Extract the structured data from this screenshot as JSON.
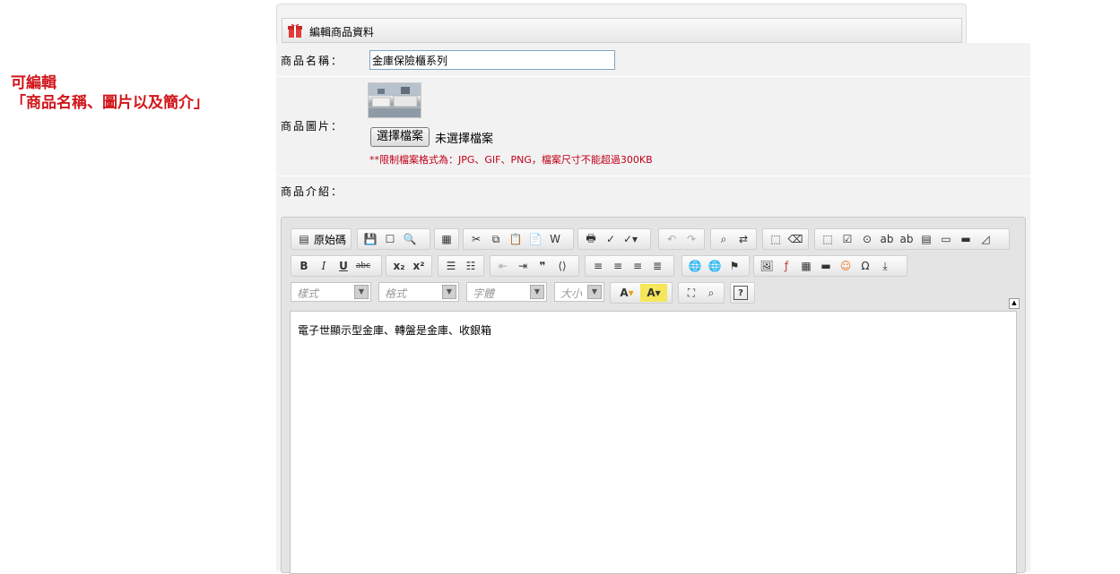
{
  "annotation": {
    "line1": "可編輯",
    "line2": "「商品名稱、圖片以及簡介」"
  },
  "panel": {
    "title": "編輯商品資料"
  },
  "form": {
    "name_label": "商品名稱：",
    "name_value": "金庫保險櫃系列",
    "image_label": "商品圖片：",
    "file_button": "選擇檔案",
    "file_status": "未選擇檔案",
    "file_note": "**限制檔案格式為：JPG、GIF、PNG，檔案尺寸不能超過300KB",
    "intro_label": "商品介紹："
  },
  "editor": {
    "source_label": "原始碼",
    "style_combo": "樣式",
    "format_combo": "格式",
    "font_combo": "字體",
    "size_combo": "大小",
    "content": "電子世顯示型金庫、轉盤是金庫、收銀箱"
  }
}
